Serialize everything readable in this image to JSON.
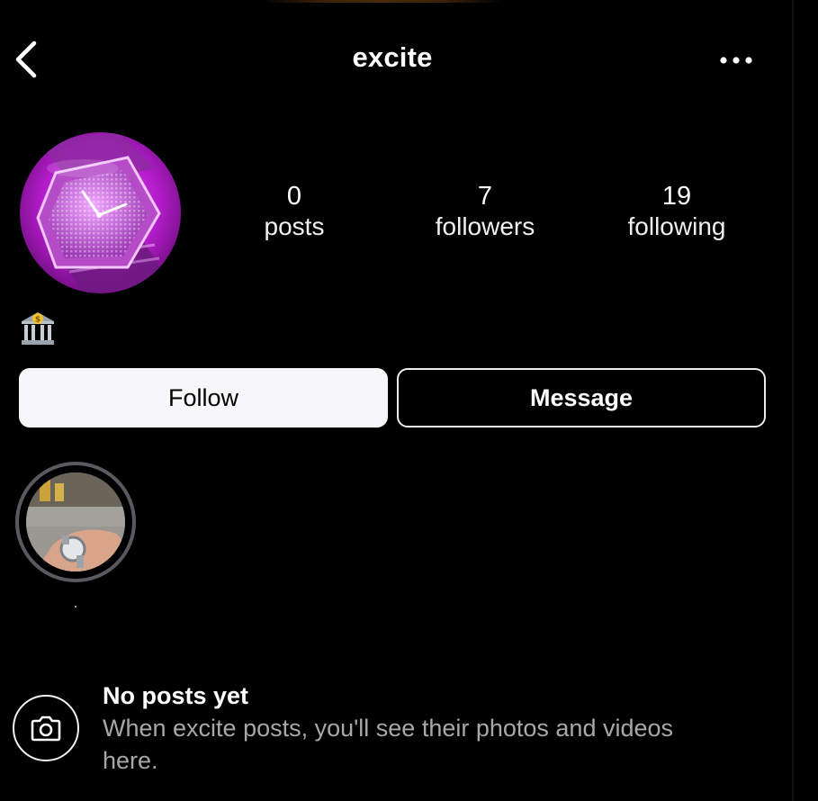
{
  "header": {
    "username": "excite"
  },
  "stats": {
    "posts": {
      "count": "0",
      "label": "posts"
    },
    "followers": {
      "count": "7",
      "label": "followers"
    },
    "following": {
      "count": "19",
      "label": "following"
    }
  },
  "bio": {
    "emoji_icon": "bank-icon"
  },
  "actions": {
    "follow_label": "Follow",
    "message_label": "Message"
  },
  "highlights": [
    {
      "label": "."
    }
  ],
  "empty_state": {
    "title": "No posts yet",
    "description": "When excite posts, you'll see their photos and videos here."
  },
  "colors": {
    "background": "#000000",
    "follow_button": "#f7f7f9",
    "secondary_text": "#a8a8a8",
    "avatar_tint": "#c21fd6"
  }
}
